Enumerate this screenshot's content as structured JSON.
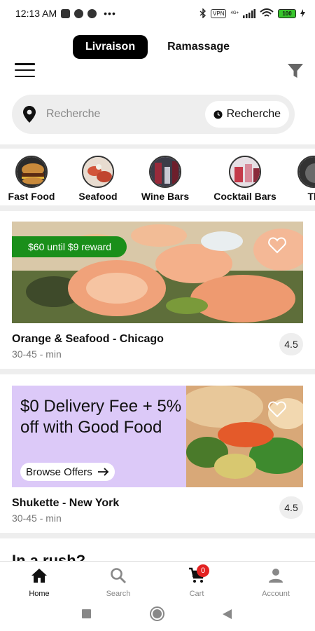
{
  "status_bar": {
    "time": "12:13 AM",
    "dots": "•••",
    "vpn": "VPN",
    "network": "4G+",
    "battery": "100"
  },
  "mode_toggle": {
    "delivery": "Livraison",
    "pickup": "Ramassage"
  },
  "search": {
    "placeholder": "Recherche",
    "schedule_label": "Recherche"
  },
  "categories": [
    {
      "label": "Fast Food",
      "icon": "burger-image"
    },
    {
      "label": "Seafood",
      "icon": "seafood-image"
    },
    {
      "label": "Wine Bars",
      "icon": "wine-bar-image"
    },
    {
      "label": "Cocktail Bars",
      "icon": "cocktail-bar-image"
    },
    {
      "label": "Th",
      "icon": "category-image"
    }
  ],
  "restaurants": [
    {
      "name": "Orange & Seafood - Chicago",
      "time": "30-45 - min",
      "rating": "4.5",
      "reward": "$60 until $9 reward"
    },
    {
      "name": "Shukette - New York",
      "time": "30-45 - min",
      "rating": "4.5",
      "promo": "$0 Delivery Fee + 5% off with Good Food",
      "promo_button": "Browse Offers"
    }
  ],
  "section_heading": "In a rush?",
  "bottom_nav": {
    "home": "Home",
    "search": "Search",
    "cart": "Cart",
    "cart_count": "0",
    "account": "Account"
  },
  "colors": {
    "accent_black": "#000000",
    "reward_green": "#1a8f1a",
    "promo_purple": "#dcc9f8",
    "cart_badge_red": "#e32222"
  }
}
